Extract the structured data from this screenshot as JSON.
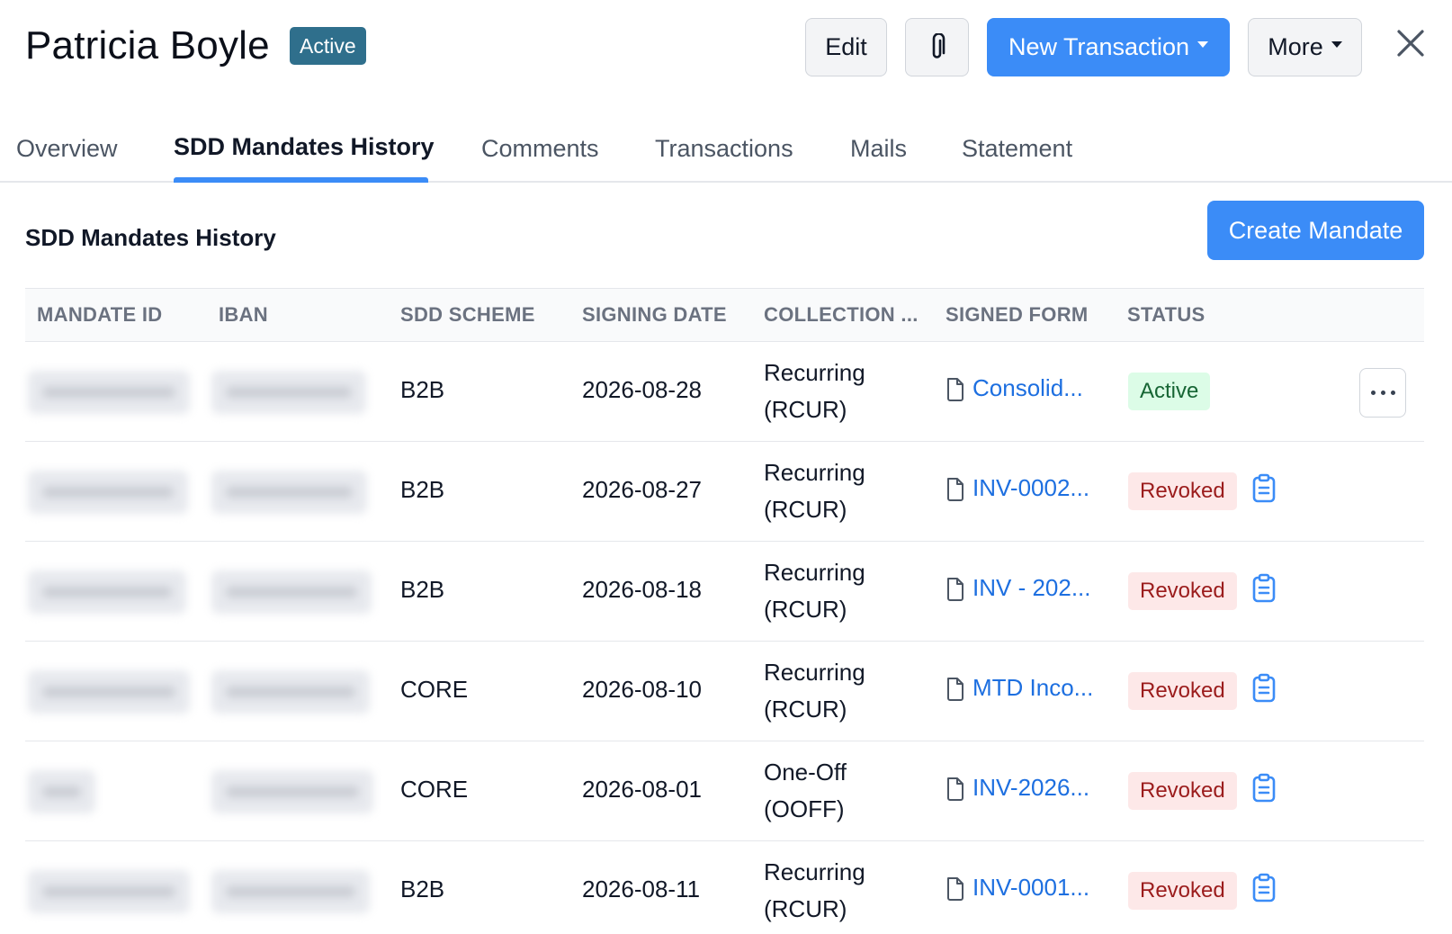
{
  "header": {
    "customer_name": "Patricia Boyle",
    "status": "Active",
    "edit_label": "Edit",
    "attach_icon": "paperclip-icon",
    "new_transaction_label": "New Transaction",
    "more_label": "More",
    "close_icon": "close-icon"
  },
  "tabs": [
    {
      "label": "Overview"
    },
    {
      "label": "SDD Mandates History",
      "active": true
    },
    {
      "label": "Comments"
    },
    {
      "label": "Transactions"
    },
    {
      "label": "Mails"
    },
    {
      "label": "Statement"
    }
  ],
  "section": {
    "title": "SDD Mandates History",
    "create_label": "Create Mandate"
  },
  "table": {
    "columns": [
      "MANDATE ID",
      "IBAN",
      "SDD SCHEME",
      "SIGNING DATE",
      "COLLECTION ...",
      "SIGNED FORM",
      "STATUS"
    ],
    "rows": [
      {
        "scheme": "B2B",
        "signing_date": "2026-08-28",
        "collection_line1": "Recurring",
        "collection_line2": "(RCUR)",
        "signed_form": "Consolid...",
        "status": "Active"
      },
      {
        "scheme": "B2B",
        "signing_date": "2026-08-27",
        "collection_line1": "Recurring",
        "collection_line2": "(RCUR)",
        "signed_form": "INV-0002...",
        "status": "Revoked"
      },
      {
        "scheme": "B2B",
        "signing_date": "2026-08-18",
        "collection_line1": "Recurring",
        "collection_line2": "(RCUR)",
        "signed_form": "INV - 202...",
        "status": "Revoked"
      },
      {
        "scheme": "CORE",
        "signing_date": "2026-08-10",
        "collection_line1": "Recurring",
        "collection_line2": "(RCUR)",
        "signed_form": "MTD Inco...",
        "status": "Revoked"
      },
      {
        "scheme": "CORE",
        "signing_date": "2026-08-01",
        "collection_line1": "One-Off",
        "collection_line2": "(OOFF)",
        "signed_form": "INV-2026...",
        "status": "Revoked"
      },
      {
        "scheme": "B2B",
        "signing_date": "2026-08-11",
        "collection_line1": "Recurring",
        "collection_line2": "(RCUR)",
        "signed_form": "INV-0001...",
        "status": "Revoked"
      }
    ]
  },
  "colors": {
    "primary": "#3b8cf7",
    "status_pill": "#2f6f8c",
    "link": "#1d6fe0",
    "active_bg": "#dcfce7",
    "active_text": "#166534",
    "revoked_bg": "#fde8e8",
    "revoked_text": "#9b1c1c"
  }
}
